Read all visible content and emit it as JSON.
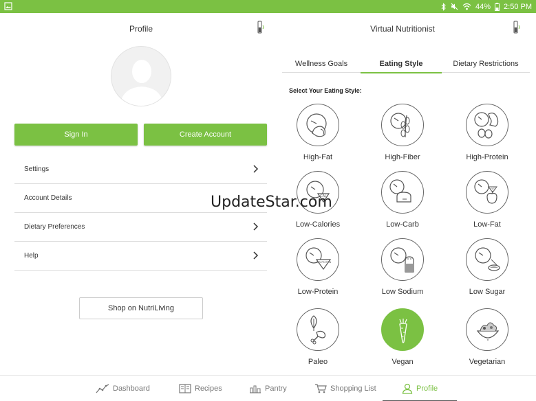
{
  "status_bar": {
    "battery": "44%",
    "time": "2:50 PM"
  },
  "profile": {
    "title": "Profile",
    "sign_in": "Sign In",
    "create_account": "Create Account",
    "menu": [
      {
        "label": "Settings"
      },
      {
        "label": "Account Details"
      },
      {
        "label": "Dietary Preferences"
      },
      {
        "label": "Help"
      }
    ],
    "shop_button": "Shop on NutriLiving"
  },
  "nutritionist": {
    "title": "Virtual Nutritionist",
    "tabs": [
      "Wellness Goals",
      "Eating Style",
      "Dietary Restrictions"
    ],
    "active_tab": "Eating Style",
    "select_label": "Select Your Eating Style:",
    "styles": [
      {
        "label": "High-Fat",
        "icon": "high-fat-icon"
      },
      {
        "label": "High-Fiber",
        "icon": "high-fiber-icon"
      },
      {
        "label": "High-Protein",
        "icon": "high-protein-icon"
      },
      {
        "label": "Low-Calories",
        "icon": "low-calories-icon",
        "badge": "CAL"
      },
      {
        "label": "Low-Carb",
        "icon": "low-carb-icon"
      },
      {
        "label": "Low-Fat",
        "icon": "low-fat-icon",
        "badge": "FAT"
      },
      {
        "label": "Low-Protein",
        "icon": "low-protein-icon",
        "badge": "LOW PROTEIN"
      },
      {
        "label": "Low Sodium",
        "icon": "low-sodium-icon"
      },
      {
        "label": "Low Sugar",
        "icon": "low-sugar-icon"
      },
      {
        "label": "Paleo",
        "icon": "paleo-icon"
      },
      {
        "label": "Vegan",
        "icon": "vegan-icon",
        "selected": true
      },
      {
        "label": "Vegetarian",
        "icon": "vegetarian-icon"
      }
    ]
  },
  "bottom_nav": [
    {
      "label": "Dashboard",
      "icon": "dashboard-icon"
    },
    {
      "label": "Recipes",
      "icon": "recipes-icon"
    },
    {
      "label": "Pantry",
      "icon": "pantry-icon"
    },
    {
      "label": "Shopping List",
      "icon": "shopping-list-icon"
    },
    {
      "label": "Profile",
      "icon": "profile-icon",
      "active": true
    }
  ],
  "watermark": "UpdateStar.com",
  "colors": {
    "accent": "#7bc143",
    "text": "#333333",
    "divider": "#dddddd"
  }
}
